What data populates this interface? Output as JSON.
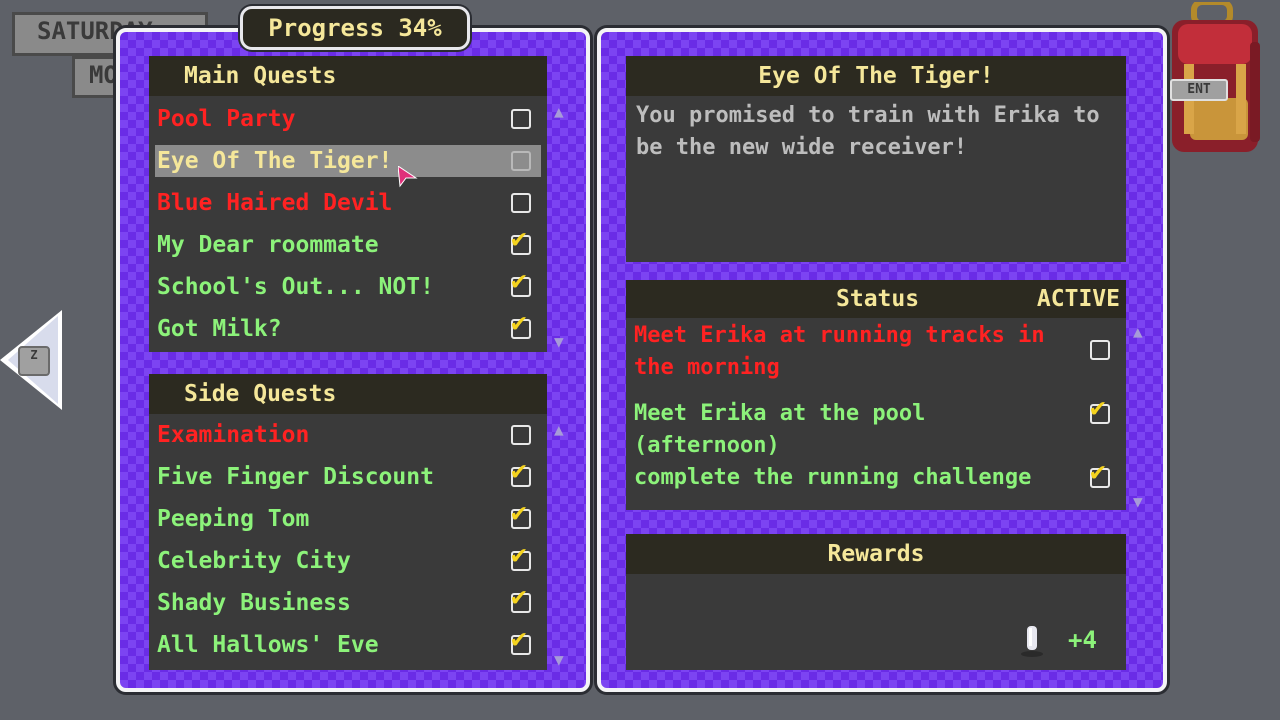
{
  "top_tags": {
    "day": "SATURDAY",
    "period": "MORNING"
  },
  "progress": {
    "label": "Progress 34%",
    "value": 34
  },
  "main_quests": {
    "title": "Main Quests",
    "items": [
      {
        "label": "Pool Party",
        "status": "open",
        "checked": false
      },
      {
        "label": "Eye Of The Tiger!",
        "status": "selected",
        "checked": false
      },
      {
        "label": "Blue Haired Devil",
        "status": "open",
        "checked": false
      },
      {
        "label": "My Dear roommate",
        "status": "done",
        "checked": true
      },
      {
        "label": "School's Out... NOT!",
        "status": "done",
        "checked": true
      },
      {
        "label": "Got Milk?",
        "status": "done",
        "checked": true
      }
    ]
  },
  "side_quests": {
    "title": "Side Quests",
    "items": [
      {
        "label": "Examination",
        "status": "open",
        "checked": false
      },
      {
        "label": "Five Finger Discount",
        "status": "done",
        "checked": true
      },
      {
        "label": "Peeping Tom",
        "status": "done",
        "checked": true
      },
      {
        "label": "Celebrity City",
        "status": "done",
        "checked": true
      },
      {
        "label": "Shady Business",
        "status": "done",
        "checked": true
      },
      {
        "label": "All Hallows' Eve",
        "status": "done",
        "checked": true
      }
    ]
  },
  "detail": {
    "title": "Eye Of The Tiger!",
    "description": "You promised to train with Erika to be the new wide receiver!"
  },
  "status": {
    "heading": "Status",
    "state": "ACTIVE",
    "tasks": [
      {
        "label": "Meet Erika at running tracks in the morning",
        "status": "open",
        "checked": false
      },
      {
        "label": "Meet Erika at the pool (afternoon)",
        "status": "done",
        "checked": true
      },
      {
        "label": "complete the running challenge",
        "status": "done",
        "checked": true
      }
    ]
  },
  "rewards": {
    "heading": "Rewards",
    "amount": "+4",
    "icon": "crystal-icon"
  },
  "backpack": {
    "key_label": "ENT"
  },
  "back": {
    "key_label": "Z"
  },
  "colors": {
    "open": "#ff2222",
    "done": "#8cf27a",
    "selected": "#f5e79a",
    "panel_purple": "#6a2ce6",
    "box_bg": "#3a3a3a"
  }
}
